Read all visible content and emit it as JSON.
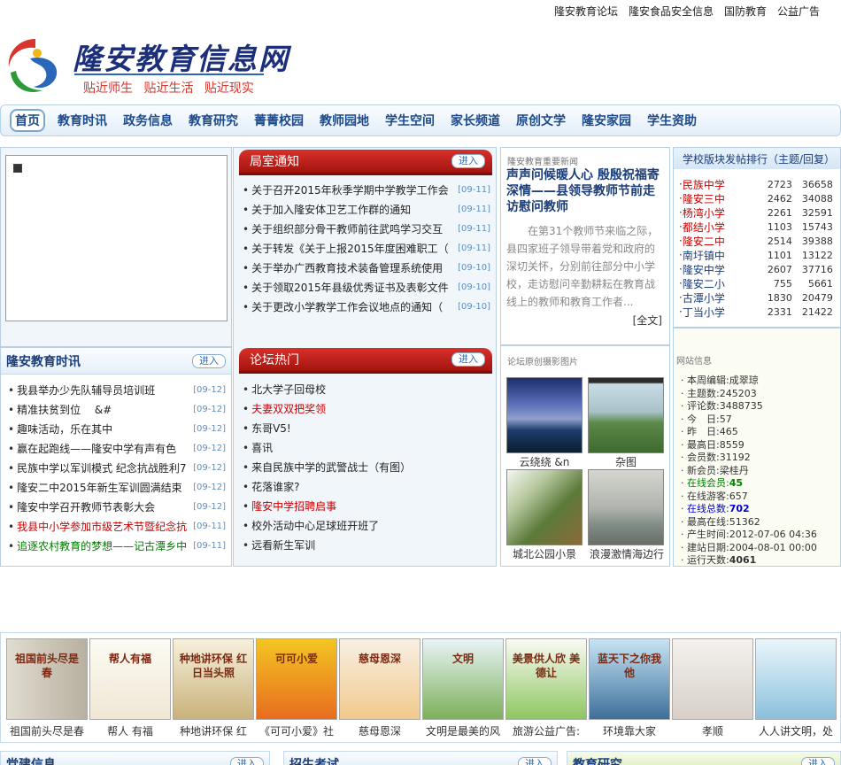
{
  "top_links": [
    "隆安教育论坛",
    "隆安食品安全信息",
    "国防教育",
    "公益广告"
  ],
  "logo": {
    "title": "隆安教育信息网",
    "slogan": "贴近师生 贴近生活 贴近现实"
  },
  "nav": [
    "首页",
    "教育时讯",
    "政务信息",
    "教育研究",
    "菁菁校园",
    "教师园地",
    "学生空间",
    "家长频道",
    "原创文学",
    "隆安家园",
    "学生资助"
  ],
  "enter_label": "进入",
  "notice": {
    "title": "局室通知",
    "items": [
      {
        "text": "关于召开2015年秋季学期中学教学工作会",
        "date": "[09-11]"
      },
      {
        "text": "关于加入隆安体卫艺工作群的通知",
        "date": "[09-11]"
      },
      {
        "text": "关于组织部分骨干教师前往武鸣学习交互",
        "date": "[09-11]"
      },
      {
        "text": "关于转发《关于上报2015年度困难职工（",
        "date": "[09-11]"
      },
      {
        "text": "关于举办广西教育技术装备管理系统使用",
        "date": "[09-10]"
      },
      {
        "text": "关于领取2015年县级优秀证书及表彰文件",
        "date": "[09-10]"
      },
      {
        "text": "关于更改小学教学工作会议地点的通知（",
        "date": "[09-10]"
      }
    ]
  },
  "news_time": {
    "title": "隆安教育时讯",
    "items": [
      {
        "text": "我县举办少先队辅导员培训班",
        "date": "[09-12]"
      },
      {
        "text": "精准扶贫到位　 &#",
        "date": "[09-12]"
      },
      {
        "text": "趣味活动，乐在其中",
        "date": "[09-12]"
      },
      {
        "text": "赢在起跑线——隆安中学有声有色",
        "date": "[09-12]"
      },
      {
        "text": "民族中学以军训模式 纪念抗战胜利7",
        "date": "[09-12]"
      },
      {
        "text": "隆安二中2015年新生军训圆满结束",
        "date": "[09-12]"
      },
      {
        "text": "隆安中学召开教师节表彰大会",
        "date": "[09-12]"
      },
      {
        "text": "我县中小学参加市级艺术节暨纪念抗",
        "date": "[09-11]",
        "color": "red"
      },
      {
        "text": "追逐农村教育的梦想——记古潭乡中",
        "date": "[09-11]",
        "color": "green"
      }
    ]
  },
  "forum": {
    "title": "论坛热门",
    "items": [
      {
        "text": "北大学子回母校"
      },
      {
        "text": "夫妻双双把奖领",
        "color": "red"
      },
      {
        "text": "东哥V5!"
      },
      {
        "text": "喜讯"
      },
      {
        "text": "来自民族中学的武警战士（有图）"
      },
      {
        "text": "花落谁家?"
      },
      {
        "text": "隆安中学招聘启事",
        "color": "red"
      },
      {
        "text": "校外活动中心足球班开班了"
      },
      {
        "text": "远看新生军训"
      }
    ]
  },
  "headline": {
    "label": "隆安教育重要新闻",
    "title": "声声问候暖人心 殷殷祝福寄深情——县领导教师节前走访慰问教师",
    "body": "在第31个教师节来临之际，县四家班子领导带着党和政府的深切关怀，分别前往部分中小学校，走访慰问辛勤耕耘在教育战线上的教师和教育工作者...",
    "more": "[全文]"
  },
  "photos": {
    "label": "论坛原创摄影图片",
    "items": [
      "云绕绕 &n",
      "杂图",
      "城北公园小景",
      "浪漫激情海边行"
    ]
  },
  "ranking": {
    "title": "学校版块发帖排行（主题/回复）",
    "items": [
      {
        "name": "民族中学",
        "a": "2723",
        "b": "36658",
        "color": "red"
      },
      {
        "name": "隆安三中",
        "a": "2462",
        "b": "34088",
        "color": "red"
      },
      {
        "name": "杨湾小学",
        "a": "2261",
        "b": "32591",
        "color": "red"
      },
      {
        "name": "都结小学",
        "a": "1103",
        "b": "15743",
        "color": "red"
      },
      {
        "name": "隆安二中",
        "a": "2514",
        "b": "39388",
        "color": "red"
      },
      {
        "name": "南圩镇中",
        "a": "1101",
        "b": "13122",
        "color": "blue"
      },
      {
        "name": "隆安中学",
        "a": "2607",
        "b": "37716",
        "color": "blue"
      },
      {
        "name": "隆安二小",
        "a": "755",
        "b": "5661",
        "color": "blue"
      },
      {
        "name": "古潭小学",
        "a": "1830",
        "b": "20479",
        "color": "blue"
      },
      {
        "name": "丁当小学",
        "a": "2331",
        "b": "21422",
        "color": "blue"
      }
    ]
  },
  "site_info": {
    "label": "网站信息",
    "items": [
      {
        "text": "本周编辑:成翠琼"
      },
      {
        "text": "主题数:245203"
      },
      {
        "text": "评论数:3488735"
      },
      {
        "text": "今　日:57"
      },
      {
        "text": "昨　日:465"
      },
      {
        "text": "最高日:8559"
      },
      {
        "text": "会员数:31192"
      },
      {
        "text": "新会员:梁桂丹"
      },
      {
        "text": "在线会员:",
        "value": "45",
        "color": "green"
      },
      {
        "text": "在线游客:657"
      },
      {
        "text": "在线总数:",
        "value": "702",
        "color": "blue"
      },
      {
        "text": "最高在线:51362"
      },
      {
        "text": "产生时间:2012-07-06 04:36"
      },
      {
        "text": "建站日期:2004-08-01 00:00"
      },
      {
        "text": "运行天数:",
        "value": "4061",
        "color": "dark"
      }
    ]
  },
  "books": [
    {
      "caption": "祖国前头尽是春",
      "cover": "祖国前头尽是春"
    },
    {
      "caption": "帮人 有福",
      "cover": "帮人有福"
    },
    {
      "caption": "种地讲环保 红",
      "cover": "种地讲环保 红日当头照"
    },
    {
      "caption": "《可可小爱》社",
      "cover": "可可小爱"
    },
    {
      "caption": "慈母恩深",
      "cover": "慈母恩深"
    },
    {
      "caption": "文明是最美的风",
      "cover": "文明"
    },
    {
      "caption": "旅游公益广告:",
      "cover": "美景供人欣 美德让"
    },
    {
      "caption": "环境靠大家",
      "cover": "蓝天下之你我他"
    },
    {
      "caption": "孝顺",
      "cover": ""
    },
    {
      "caption": "人人讲文明，处",
      "cover": ""
    }
  ],
  "bottom": [
    "党建信息",
    "招生考试",
    "教育研究"
  ]
}
